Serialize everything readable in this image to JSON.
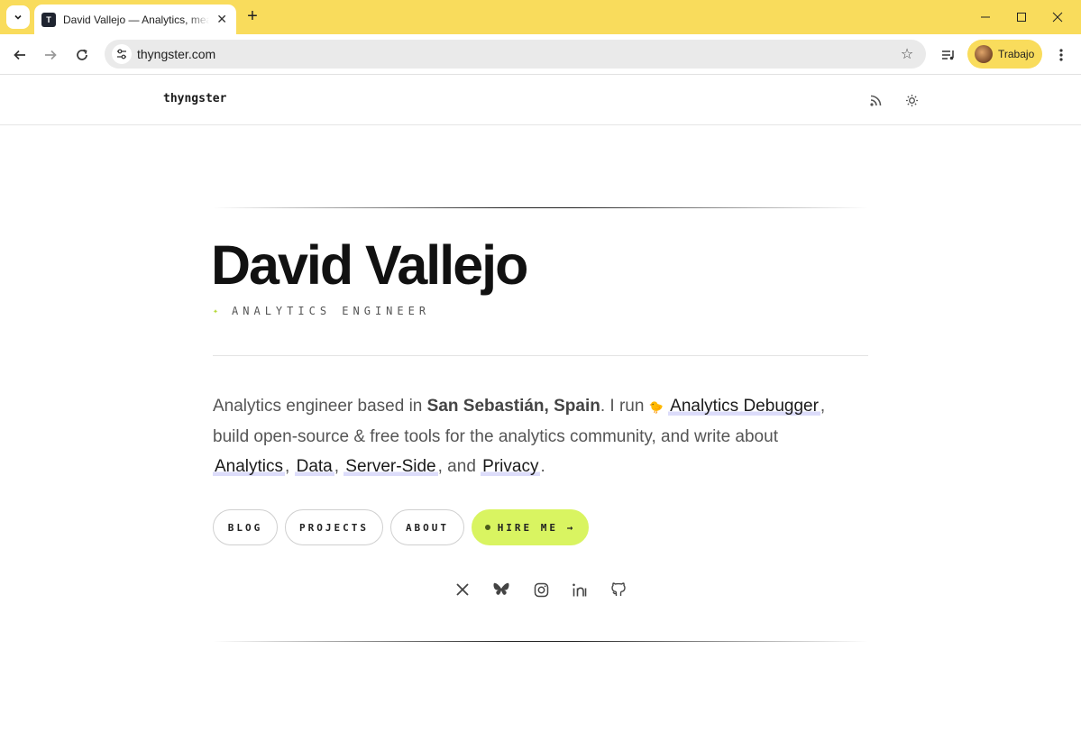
{
  "browser": {
    "tab": {
      "favicon_letter": "T",
      "title": "David Vallejo — Analytics, measurement",
      "close": "✕"
    },
    "new_tab": "+",
    "url": "thyngster.com",
    "profile_name": "Trabajo"
  },
  "site": {
    "logo": "thyngster",
    "hero": {
      "name": "David Vallejo",
      "role": "ANALYTICS ENGINEER",
      "role_bullet": "✦"
    },
    "bio": {
      "p1": "Analytics engineer based in ",
      "location": "San Sebastián, Spain",
      "p2": ". I run ",
      "emoji": "🐤",
      "link_debugger": "Analytics Debugger",
      "p3": ",",
      "p4": "build open-source & free tools for the analytics community, and write about",
      "link_analytics": "Analytics",
      "sep1": ",",
      "link_data": "Data",
      "sep2": ",",
      "link_server": "Server-Side",
      "p5": ", and",
      "link_privacy": "Privacy",
      "end": "."
    },
    "buttons": {
      "blog": "BLOG",
      "projects": "PROJECTS",
      "about": "ABOUT",
      "hire": "HIRE ME →"
    },
    "social_icons": [
      "x-icon",
      "bluesky-icon",
      "instagram-icon",
      "linkedin-icon",
      "github-icon"
    ]
  },
  "colors": {
    "chrome_accent": "#f9dc5c",
    "hire_button": "#d9f461",
    "link_underline": "#dcdcfa"
  }
}
